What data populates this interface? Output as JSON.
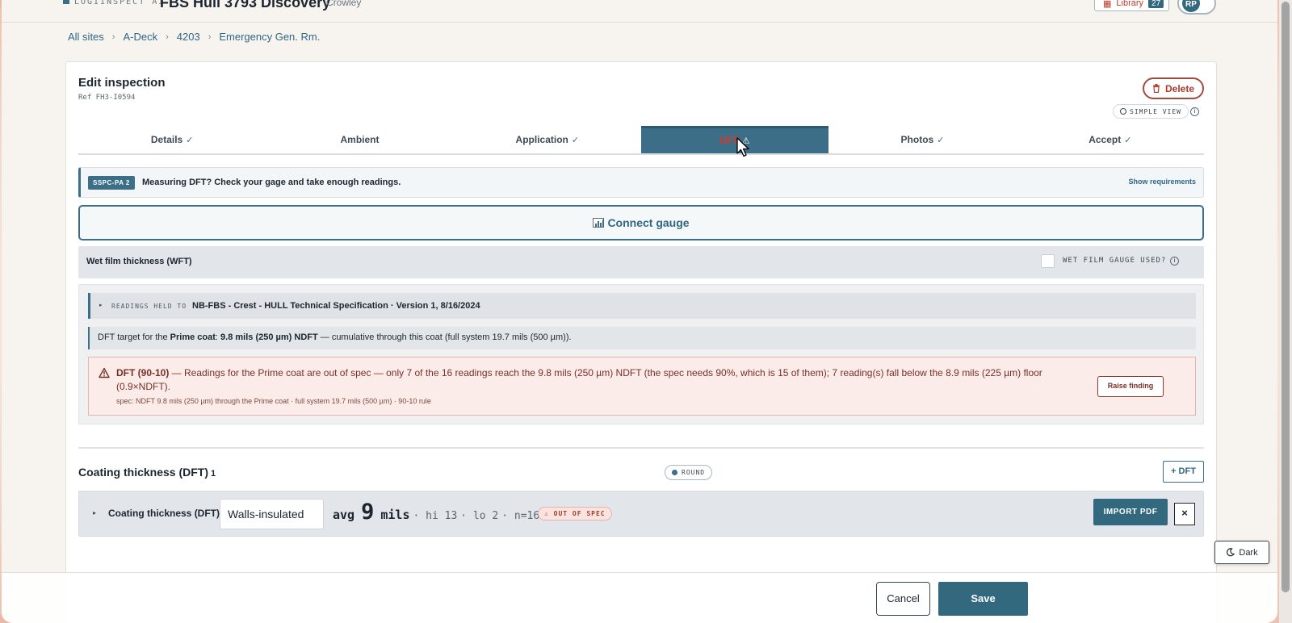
{
  "header": {
    "logo_text": "LOGIINSPECT AI",
    "vessel_title": "FBS Hull 3793 Discovery",
    "separator": "·",
    "owner": "Crowley",
    "library_label": "Library",
    "library_count": "27",
    "avatar_initials": "RP"
  },
  "breadcrumb": [
    "All sites",
    "A-Deck",
    "4203",
    "Emergency Gen. Rm."
  ],
  "breadcrumb_sep": "›",
  "card": {
    "title": "Edit inspection",
    "ref": "Ref FH3-I0594",
    "delete_label": "Delete",
    "simple_view_label": "SIMPLE VIEW"
  },
  "tabs": [
    {
      "label": "Details",
      "mark": "✓"
    },
    {
      "label": "Ambient",
      "mark": ""
    },
    {
      "label": "Application",
      "mark": "✓"
    },
    {
      "label": "DFT",
      "mark": "⚠"
    },
    {
      "label": "Photos",
      "mark": "✓"
    },
    {
      "label": "Accept",
      "mark": "✓"
    }
  ],
  "active_tab": "DFT",
  "sspc": {
    "badge": "SSPC-PA 2",
    "message": "Measuring DFT? Check your gage and take enough readings.",
    "requirements_link": "Show requirements"
  },
  "connect_gauge_label": "Connect gauge",
  "wft": {
    "label": "Wet film thickness (WFT)",
    "checkbox_label": "WET FILM GAUGE USED?"
  },
  "spec": {
    "held_key": "READINGS HELD TO",
    "held_value": "NB-FBS - Crest - HULL Technical Specification · Version 1, 8/16/2024",
    "target_prefix": "DFT target for the ",
    "target_coat": "Prime coat",
    "target_colon": ": ",
    "target_value": "9.8 mils (250 µm) NDFT",
    "target_suffix": " — cumulative through this coat (full system 19.7 mils (500 µm)).",
    "alert_title": "DFT (90-10)",
    "alert_text": " — Readings for the Prime coat are out of spec — only 7 of the 16 readings reach the 9.8 mils (250 µm) NDFT (the spec needs 90%, which is 15 of them); 7 reading(s) fall below the 8.9 mils (225 µm) floor (0.9×NDFT).",
    "alert_sub": "spec: NDFT 9.8 mils (250 µm) through the Prime coat · full system 19.7 mils (500 µm) · 90-10 rule",
    "raise_label": "Raise finding"
  },
  "coating": {
    "title": "Coating thickness (DFT)",
    "count": "1",
    "round_label": "ROUND",
    "add_label": "+ DFT",
    "row_label": "Coating thickness (DFT)",
    "location_value": "Walls-insulated",
    "avg_label": "avg",
    "avg_value": "9",
    "unit": "mils",
    "hi": "· hi 13",
    "lo": "· lo 2",
    "n": "· n=16",
    "status": "⚠ OUT OF SPEC",
    "import_label": "IMPORT PDF",
    "close_label": "×"
  },
  "dark_toggle_label": "Dark",
  "footer": {
    "cancel_label": "Cancel",
    "save_label": "Save"
  },
  "colors": {
    "accent": "#3c6e88",
    "danger": "#b0392b",
    "alert_bg": "#fbecea"
  }
}
